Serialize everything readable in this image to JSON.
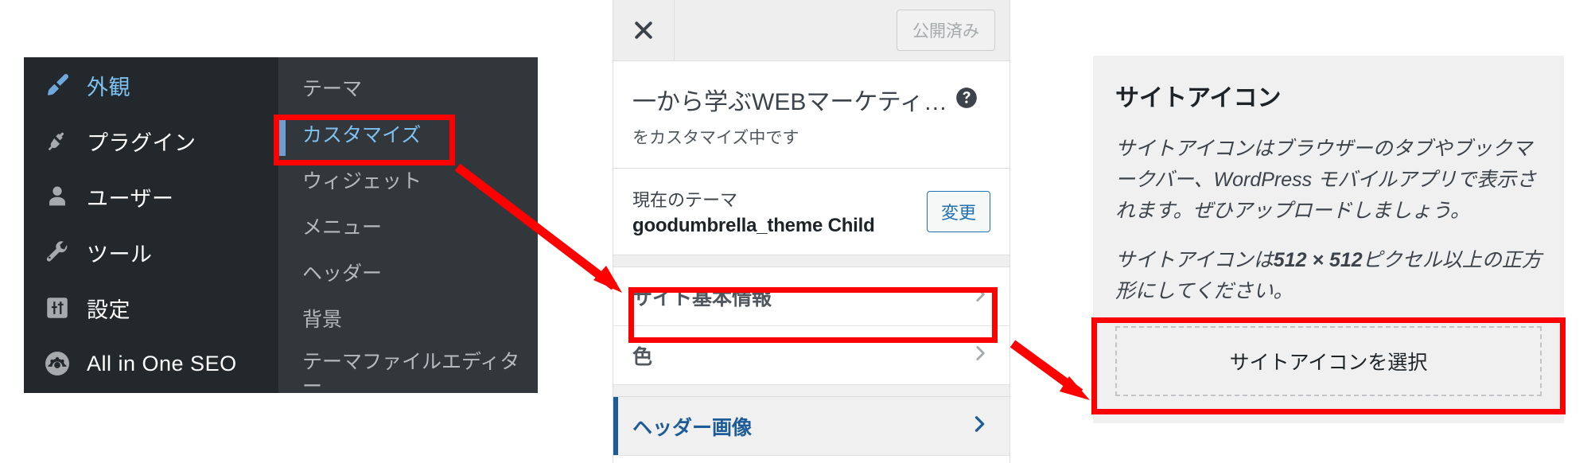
{
  "admin_menu": {
    "items": [
      {
        "label": "外観",
        "icon": "appearance-brush-icon",
        "current": true
      },
      {
        "label": "プラグイン",
        "icon": "plugin-plug-icon",
        "current": false
      },
      {
        "label": "ユーザー",
        "icon": "users-person-icon",
        "current": false
      },
      {
        "label": "ツール",
        "icon": "tools-wrench-icon",
        "current": false
      },
      {
        "label": "設定",
        "icon": "settings-sliders-icon",
        "current": false
      },
      {
        "label": "All in One SEO",
        "icon": "aioseo-gear-icon",
        "current": false
      }
    ],
    "submenu": [
      {
        "label": "テーマ",
        "current": false
      },
      {
        "label": "カスタマイズ",
        "current": true
      },
      {
        "label": "ウィジェット",
        "current": false
      },
      {
        "label": "メニュー",
        "current": false
      },
      {
        "label": "ヘッダー",
        "current": false
      },
      {
        "label": "背景",
        "current": false
      },
      {
        "label": "テーマファイルエディター",
        "current": false
      }
    ]
  },
  "customizer": {
    "close_label": "×",
    "publish_label": "公開済み",
    "title": "一から学ぶWEBマーケティ…",
    "subtitle": "をカスタマイズ中です",
    "help_icon": "help-question-icon",
    "theme": {
      "label": "現在のテーマ",
      "name": "goodumbrella_theme Child",
      "change_label": "変更"
    },
    "rows": [
      {
        "label": "サイト基本情報",
        "accent": false,
        "chevron": "chevron-right-icon"
      },
      {
        "label": "色",
        "accent": false,
        "chevron": "chevron-right-icon"
      },
      {
        "label": "ヘッダー画像",
        "accent": true,
        "chevron": "chevron-right-icon"
      }
    ]
  },
  "site_icon": {
    "heading": "サイトアイコン",
    "paragraph_1_a": "サイトアイコンはブラウザーのタブやブックマークバー、",
    "paragraph_1_b": "WordPress",
    "paragraph_1_c": " モバイルアプリで表示されます。ぜひアップロードしましょう。",
    "paragraph_2_a": "サイトアイコンは",
    "paragraph_2_b": "512 × 512",
    "paragraph_2_c": "ピクセル以上の正方形にしてください。",
    "select_button": "サイトアイコンを選択"
  },
  "annotations": {
    "highlight_color": "#ff0000",
    "boxes": [
      {
        "name": "customize-menu-highlight"
      },
      {
        "name": "site-basic-info-highlight"
      },
      {
        "name": "select-site-icon-highlight"
      }
    ],
    "arrows": [
      {
        "name": "arrow-customize-to-site-basic-info"
      },
      {
        "name": "arrow-site-basic-info-to-site-icon"
      }
    ]
  }
}
